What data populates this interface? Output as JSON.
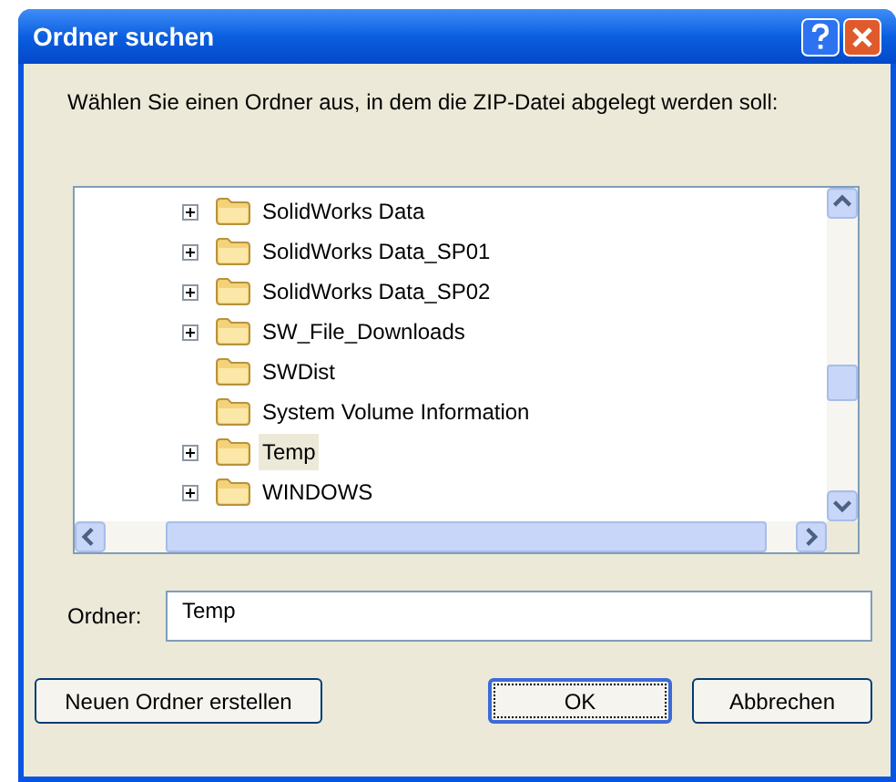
{
  "window": {
    "title": "Ordner suchen"
  },
  "instruction": "Wählen Sie einen Ordner aus, in dem die ZIP-Datei abgelegt werden soll:",
  "tree": {
    "items": [
      {
        "label": "SolidWorks Data",
        "expandable": true,
        "selected": false
      },
      {
        "label": "SolidWorks Data_SP01",
        "expandable": true,
        "selected": false
      },
      {
        "label": "SolidWorks Data_SP02",
        "expandable": true,
        "selected": false
      },
      {
        "label": "SW_File_Downloads",
        "expandable": true,
        "selected": false
      },
      {
        "label": "SWDist",
        "expandable": false,
        "selected": false
      },
      {
        "label": "System Volume Information",
        "expandable": false,
        "selected": false
      },
      {
        "label": "Temp",
        "expandable": true,
        "selected": true
      },
      {
        "label": "WINDOWS",
        "expandable": true,
        "selected": false
      }
    ]
  },
  "folder_field": {
    "label": "Ordner:",
    "value": "Temp"
  },
  "buttons": [
    {
      "label": "Neuen Ordner erstellen",
      "default": false
    },
    {
      "label": "OK",
      "default": true
    },
    {
      "label": "Abbrechen",
      "default": false
    }
  ]
}
